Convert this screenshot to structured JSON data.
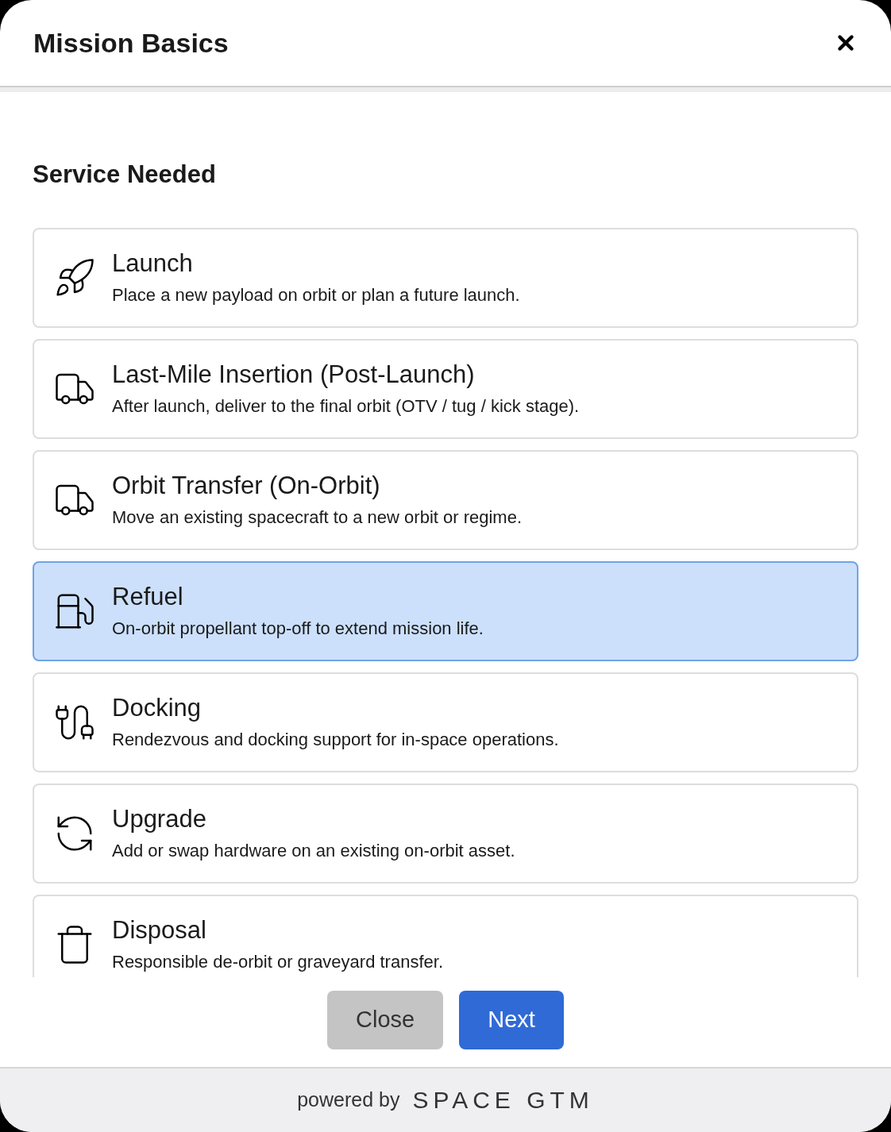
{
  "dialog": {
    "title": "Mission Basics"
  },
  "section": {
    "title": "Service Needed"
  },
  "options": [
    {
      "title": "Launch",
      "description": "Place a new payload on orbit or plan a future launch.",
      "selected": false
    },
    {
      "title": "Last-Mile Insertion (Post-Launch)",
      "description": "After launch, deliver to the final orbit (OTV / tug / kick stage).",
      "selected": false
    },
    {
      "title": "Orbit Transfer (On-Orbit)",
      "description": "Move an existing spacecraft to a new orbit or regime.",
      "selected": false
    },
    {
      "title": "Refuel",
      "description": "On-orbit propellant top-off to extend mission life.",
      "selected": true
    },
    {
      "title": "Docking",
      "description": "Rendezvous and docking support for in-space operations.",
      "selected": false
    },
    {
      "title": "Upgrade",
      "description": "Add or swap hardware on an existing on-orbit asset.",
      "selected": false
    },
    {
      "title": "Disposal",
      "description": "Responsible de-orbit or graveyard transfer.",
      "selected": false
    }
  ],
  "buttons": [
    {
      "label": "Close",
      "kind": "secondary"
    },
    {
      "label": "Next",
      "kind": "primary"
    }
  ],
  "footer": {
    "text": "powered by",
    "logo": "SPACE GTM"
  }
}
